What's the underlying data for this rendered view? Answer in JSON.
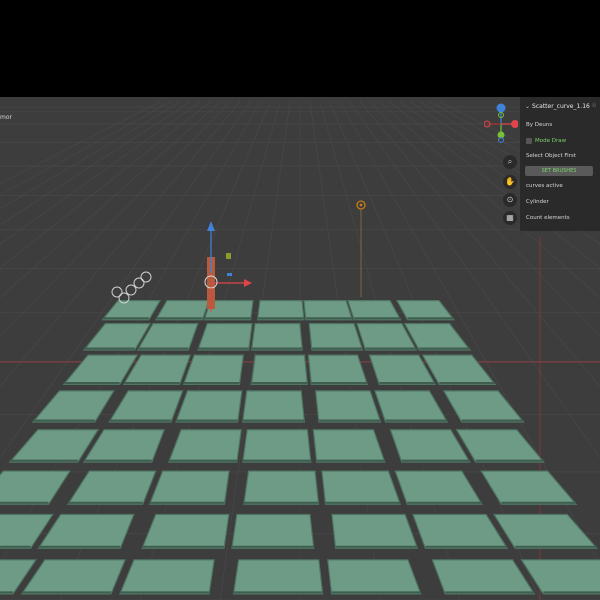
{
  "viewport": {
    "header_fragment": "mor"
  },
  "npanel": {
    "title": "Scatter_curve_1.16",
    "menu_icon": "drag-dots-icon",
    "author": "By Deuns",
    "mode_toggle_label": "Mode Draw",
    "instruction": "Select Object First",
    "button_label": "SET BRUSHES",
    "curves_active": "curves active",
    "object_name": "Cylinder",
    "count_label": "Count elements"
  },
  "gizmo": {
    "x_label": "X",
    "y_label": "Y",
    "z_label": "Z",
    "colors": {
      "x": "#e0454a",
      "y": "#78c037",
      "z": "#3f82d8"
    }
  },
  "nav_icons": {
    "zoom": "zoom-icon",
    "pan": "pan-hand-icon",
    "camera": "camera-icon",
    "grid": "grid-view-icon"
  },
  "scene_colors": {
    "background": "#3d3d3d",
    "tile": "#6e9b86",
    "tile_edge": "#4f7664",
    "grid_line": "#4a4a4a",
    "axis_x": "#a8373c",
    "cursor": "#c87a18"
  }
}
